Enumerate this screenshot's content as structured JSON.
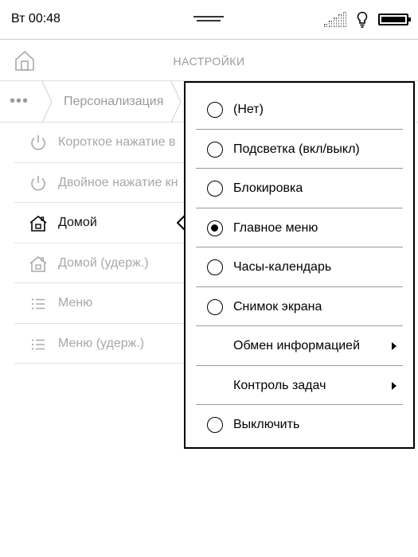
{
  "status_bar": {
    "time": "Вт 00:48",
    "icons": [
      "drag-handle-icon",
      "signal-icon",
      "bulb-icon",
      "battery-icon"
    ]
  },
  "header": {
    "title": "НАСТРОЙКИ",
    "home_icon": "home-icon"
  },
  "breadcrumb": {
    "more": "•••",
    "current": "Персонализация"
  },
  "settings_list": [
    {
      "label": "Короткое нажатие в",
      "icon": "power-icon",
      "active": false
    },
    {
      "label": "Двойное нажатие кн",
      "icon": "power-icon",
      "active": false
    },
    {
      "label": "Домой",
      "icon": "home-icon",
      "active": true
    },
    {
      "label": "Домой (удерж.)",
      "icon": "home-icon",
      "active": false
    },
    {
      "label": "Меню",
      "icon": "list-icon",
      "active": false
    },
    {
      "label": "Меню (удерж.)",
      "icon": "list-icon",
      "active": false
    }
  ],
  "popup_menu": {
    "items": [
      {
        "label": "(Нет)",
        "type": "radio",
        "selected": false
      },
      {
        "label": "Подсветка (вкл/выкл)",
        "type": "radio",
        "selected": false
      },
      {
        "label": "Блокировка",
        "type": "radio",
        "selected": false
      },
      {
        "label": "Главное меню",
        "type": "radio",
        "selected": true
      },
      {
        "label": "Часы-календарь",
        "type": "radio",
        "selected": false
      },
      {
        "label": "Снимок экрана",
        "type": "radio",
        "selected": false
      },
      {
        "label": "Обмен информацией",
        "type": "submenu",
        "selected": false
      },
      {
        "label": "Контроль задач",
        "type": "submenu",
        "selected": false
      },
      {
        "label": "Выключить",
        "type": "radio",
        "selected": false
      }
    ]
  }
}
